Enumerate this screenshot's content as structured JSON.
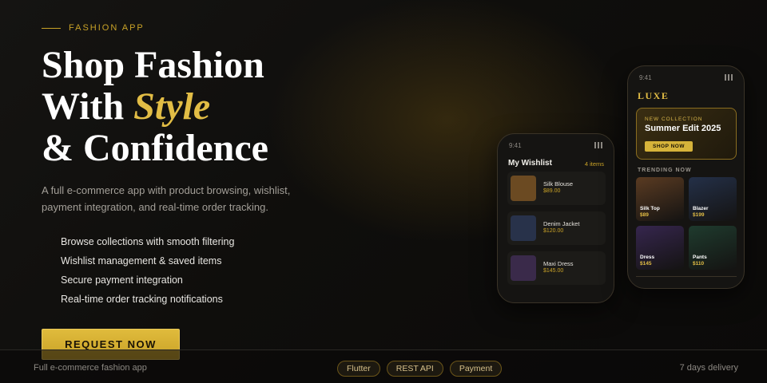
{
  "eyebrow": "FASHION APP",
  "headline": {
    "line1": "Shop Fashion",
    "line2_prefix": "With ",
    "line2_accent": "Style",
    "line3": "& Confidence"
  },
  "description": "A full e-commerce app with product browsing, wishlist, payment integration, and real-time order tracking.",
  "features": [
    "Browse collections with smooth filtering",
    "Wishlist management & saved items",
    "Secure payment integration",
    "Real-time order tracking notifications"
  ],
  "cta_label": "REQUEST NOW",
  "footer": {
    "left": "Full e-commerce fashion app",
    "tags": [
      "Flutter",
      "REST API",
      "Payment"
    ],
    "right": "7 days delivery"
  },
  "colors": {
    "accent": "#c9a227",
    "accent_light": "#e2bd45",
    "background": "#0f0e0c"
  },
  "wishlist_phone": {
    "time": "9:41",
    "title": "My Wishlist",
    "count": "4 items",
    "items": [
      {
        "name": "Silk Blouse",
        "price": "$89.00",
        "color": "#6b4a22"
      },
      {
        "name": "Denim Jacket",
        "price": "$120.00",
        "color": "#28324a"
      },
      {
        "name": "Maxi Dress",
        "price": "$145.00",
        "color": "#3a2a4a"
      }
    ]
  },
  "shop_phone": {
    "time": "9:41",
    "brand": "LUXE",
    "hero": {
      "subtitle": "NEW COLLECTION",
      "title": "Summer Edit 2025",
      "button": "SHOP NOW"
    },
    "trending_label": "TRENDING NOW",
    "products": [
      {
        "name": "Silk Top",
        "price": "$89",
        "color": "#5a3b22"
      },
      {
        "name": "Blazer",
        "price": "$199",
        "color": "#243048"
      },
      {
        "name": "Dress",
        "price": "$145",
        "color": "#36264e"
      },
      {
        "name": "Pants",
        "price": "$110",
        "color": "#1f3b2e"
      }
    ]
  }
}
